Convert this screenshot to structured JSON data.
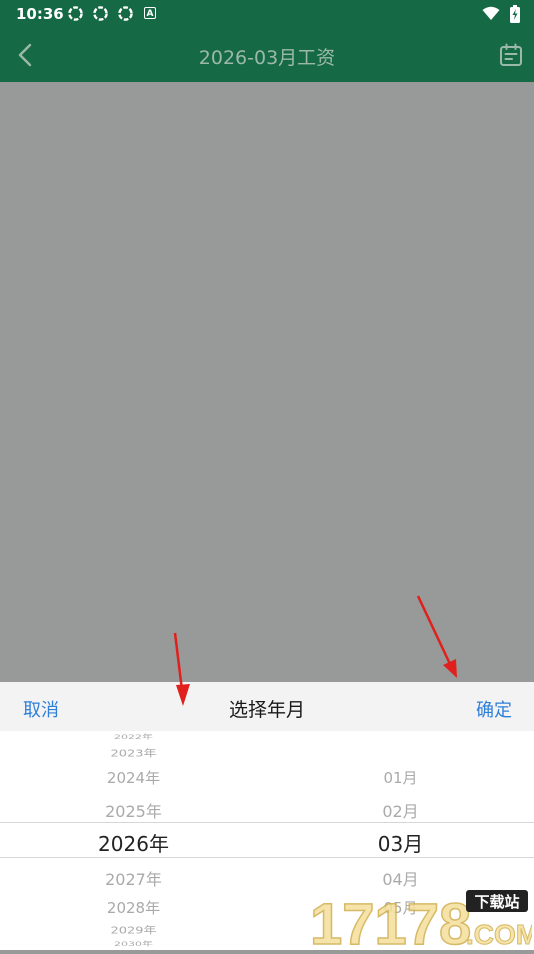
{
  "status_bar": {
    "time": "10:36",
    "icons": [
      "notification-icon",
      "notification-icon",
      "notification-icon",
      "a-badge-icon",
      "wifi-icon",
      "battery-charging-icon"
    ],
    "a_badge": "A"
  },
  "app_bar": {
    "title": "2026-03月工资",
    "back_icon": "chevron-left-icon",
    "calendar_icon": "calendar-icon"
  },
  "picker": {
    "cancel_label": "取消",
    "title": "选择年月",
    "confirm_label": "确定",
    "years": [
      "2022年",
      "2023年",
      "2024年",
      "2025年",
      "2026年",
      "2027年",
      "2028年",
      "2029年",
      "2030年"
    ],
    "months": [
      "01月",
      "02月",
      "03月",
      "04月",
      "05月"
    ],
    "selected_year": "2026年",
    "selected_month": "03月"
  },
  "watermark": {
    "number": "17178",
    "badge": "下载站",
    "domain": ".COM"
  },
  "colors": {
    "app_bar": "#156a45",
    "overlay": "#989a99",
    "accent_text": "#2f7fd9",
    "arrow": "#e0201c"
  }
}
